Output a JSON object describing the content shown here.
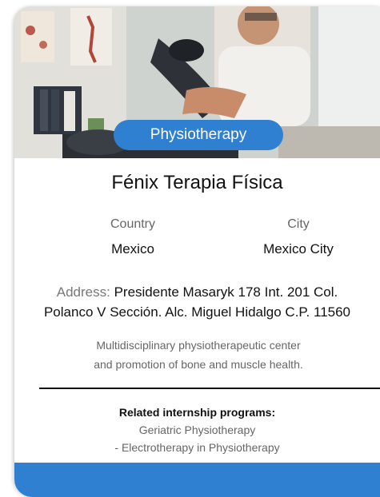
{
  "badge": "Physiotherapy",
  "name": "Fénix Terapia Física",
  "country": {
    "label": "Country",
    "value": "Mexico"
  },
  "city": {
    "label": "City",
    "value": "Mexico City"
  },
  "address": {
    "label": "Address:",
    "line1": "Presidente Masaryk 178 Int. 201 Col.",
    "line2": "Polanco V Sección. Alc. Miguel Hidalgo C.P. 11560"
  },
  "description": {
    "line1": "Multidisciplinary physiotherapeutic center",
    "line2": "and promotion of bone and muscle health."
  },
  "related": {
    "heading": "Related internship programs:",
    "items": [
      "Geriatric Physiotherapy",
      "- Electrotherapy in Physiotherapy"
    ]
  },
  "colors": {
    "accent": "#2f80d1"
  }
}
